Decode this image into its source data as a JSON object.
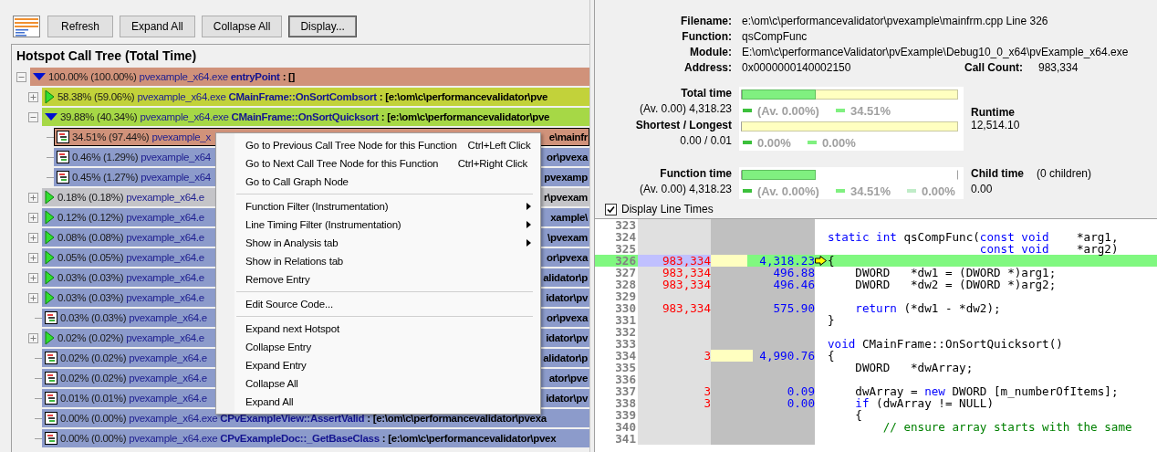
{
  "toolbar": {
    "buttons": [
      {
        "label": "Refresh",
        "default": false
      },
      {
        "label": "Expand All",
        "default": false
      },
      {
        "label": "Collapse All",
        "default": false
      },
      {
        "label": "Display...",
        "default": true
      }
    ]
  },
  "call_tree": {
    "title": "Hotspot Call Tree (Total Time)",
    "nodes": [
      {
        "kind": "branch",
        "expanded": true,
        "selected": false,
        "color": "#d0927a",
        "percent": "100.00% (100.00%)",
        "module": "pvexample_x64.exe",
        "function": "entryPoint",
        "location": ": []",
        "children": [
          {
            "kind": "branch",
            "expanded": false,
            "selected": false,
            "color": "#c2d23a",
            "percent": "58.38% (59.06%)",
            "module": "pvexample_x64.exe",
            "function": "CMainFrame::OnSortCombsort",
            "location": ": [e:\\om\\c\\performancevalidator\\pve"
          },
          {
            "kind": "branch",
            "expanded": true,
            "selected": false,
            "color": "#a6d846",
            "percent": "39.88% (40.34%)",
            "module": "pvexample_x64.exe",
            "function": "CMainFrame::OnSortQuicksort",
            "location": ": [e:\\om\\c\\performancevalidator\\pve",
            "children": [
              {
                "kind": "leaf",
                "selected": true,
                "color": "#d0927a",
                "percent": "34.51% (97.44%)",
                "module": "pvexample_x",
                "tail": "e\\mainfr"
              },
              {
                "kind": "leaf",
                "selected": false,
                "color": "#8c9bcb",
                "percent": "0.46% (1.29%)",
                "module": "pvexample_x64",
                "tail": "or\\pvexa"
              },
              {
                "kind": "leaf",
                "selected": false,
                "color": "#8c9bcb",
                "percent": "0.45% (1.27%)",
                "module": "pvexample_x64",
                "tail": "pvexamp"
              }
            ]
          },
          {
            "kind": "branch",
            "expanded": false,
            "selected": false,
            "color": "#c4c4c8",
            "percent": "0.18% (0.18%)",
            "module": "pvexample_x64.e",
            "tail": "r\\pvexam"
          },
          {
            "kind": "branch",
            "expanded": false,
            "selected": false,
            "color": "#8c9bcb",
            "percent": "0.12% (0.12%)",
            "module": "pvexample_x64.e",
            "tail": "xample\\"
          },
          {
            "kind": "branch",
            "expanded": false,
            "selected": false,
            "color": "#8c9bcb",
            "percent": "0.08% (0.08%)",
            "module": "pvexample_x64.e",
            "tail": "\\pvexam"
          },
          {
            "kind": "branch",
            "expanded": false,
            "selected": false,
            "color": "#8c9bcb",
            "percent": "0.05% (0.05%)",
            "module": "pvexample_x64.e",
            "tail": "or\\pvexa"
          },
          {
            "kind": "branch",
            "expanded": false,
            "selected": false,
            "color": "#8c9bcb",
            "percent": "0.03% (0.03%)",
            "module": "pvexample_x64.e",
            "tail": "alidator\\p"
          },
          {
            "kind": "branch",
            "expanded": false,
            "selected": false,
            "color": "#8c9bcb",
            "percent": "0.03% (0.03%)",
            "module": "pvexample_x64.e",
            "tail": "idator\\pv"
          },
          {
            "kind": "leaf",
            "selected": false,
            "color": "#8c9bcb",
            "percent": "0.03% (0.03%)",
            "module": "pvexample_x64.e",
            "tail": "or\\pvexa"
          },
          {
            "kind": "branch",
            "expanded": false,
            "selected": false,
            "color": "#8c9bcb",
            "percent": "0.02% (0.02%)",
            "module": "pvexample_x64.e",
            "tail": "idator\\pv"
          },
          {
            "kind": "leaf",
            "selected": false,
            "color": "#8c9bcb",
            "percent": "0.02% (0.02%)",
            "module": "pvexample_x64.e",
            "tail": "alidator\\p"
          },
          {
            "kind": "leaf",
            "selected": false,
            "color": "#8c9bcb",
            "percent": "0.02% (0.02%)",
            "module": "pvexample_x64.e",
            "tail": "ator\\pve"
          },
          {
            "kind": "leaf",
            "selected": false,
            "color": "#8c9bcb",
            "percent": "0.01% (0.01%)",
            "module": "pvexample_x64.e",
            "tail": "idator\\pv"
          },
          {
            "kind": "leaf",
            "selected": false,
            "color": "#8c9bcb",
            "percent": "0.00% (0.00%)",
            "module": "pvexample_x64.exe",
            "function": "CPvExampleView::AssertValid",
            "location": ": [e:\\om\\c\\performancevalidator\\pvexa"
          },
          {
            "kind": "leaf",
            "selected": false,
            "color": "#8c9bcb",
            "percent": "0.00% (0.00%)",
            "module": "pvexample_x64.exe",
            "function": "CPvExampleDoc::_GetBaseClass",
            "location": ": [e:\\om\\c\\performancevalidator\\pvex"
          }
        ]
      }
    ]
  },
  "context_menu": {
    "items": [
      {
        "kind": "item",
        "label": "Go to Previous Call Tree Node for this Function",
        "shortcut": "Ctrl+Left Click",
        "submenu": false
      },
      {
        "kind": "item",
        "label": "Go to Next Call Tree Node for this Function",
        "shortcut": "Ctrl+Right Click",
        "submenu": false
      },
      {
        "kind": "item",
        "label": "Go to Call Graph Node",
        "submenu": false
      },
      {
        "kind": "separator"
      },
      {
        "kind": "item",
        "label": "Function Filter (Instrumentation)",
        "submenu": true
      },
      {
        "kind": "item",
        "label": "Line Timing Filter (Instrumentation)",
        "submenu": true
      },
      {
        "kind": "item",
        "label": "Show in Analysis tab",
        "submenu": true
      },
      {
        "kind": "item",
        "label": "Show in Relations tab",
        "submenu": false
      },
      {
        "kind": "item",
        "label": "Remove Entry",
        "submenu": false
      },
      {
        "kind": "separator"
      },
      {
        "kind": "item",
        "label": "Edit Source Code...",
        "submenu": false
      },
      {
        "kind": "separator"
      },
      {
        "kind": "item",
        "label": "Expand next Hotspot",
        "submenu": false
      },
      {
        "kind": "item",
        "label": "Collapse Entry",
        "submenu": false
      },
      {
        "kind": "item",
        "label": "Expand Entry",
        "submenu": false
      },
      {
        "kind": "item",
        "label": "Collapse All",
        "submenu": false
      },
      {
        "kind": "item",
        "label": "Expand All",
        "submenu": false
      }
    ]
  },
  "details": {
    "fields": [
      {
        "label": "Filename:",
        "value": "e:\\om\\c\\performancevalidator\\pvexample\\mainfrm.cpp Line 326"
      },
      {
        "label": "Function:",
        "value": "qsCompFunc"
      },
      {
        "label": "Module:",
        "value": "E:\\om\\c\\performanceValidator\\pvExample\\Debug10_0_x64\\pvExample_x64.exe"
      },
      {
        "label": "Address:",
        "value": "0x0000000140002150"
      }
    ],
    "call_count": {
      "label": "Call Count:",
      "value": "983,334"
    },
    "metrics": [
      {
        "label": "Total time",
        "value": "(Av. 0.00) 4,318.23",
        "level": 0.345,
        "track": true,
        "legend": [
          {
            "text": "(Av. 0.00%)",
            "color": "#3cc03c"
          },
          {
            "text": "34.51%",
            "color": "#80f080"
          }
        ]
      },
      {
        "label": "Shortest / Longest",
        "value": "0.00 / 0.01",
        "track": true,
        "legend": [
          {
            "text": "0.00%",
            "color": "#3cc03c"
          },
          {
            "text": "0.00%",
            "color": "#80f080"
          }
        ]
      },
      {
        "label": "Function time",
        "value": "(Av. 0.00) 4,318.23",
        "level": 0.345,
        "track": false,
        "legend": [
          {
            "text": "(Av. 0.00%)",
            "color": "#3cc03c"
          },
          {
            "text": "34.51%",
            "color": "#80f080"
          },
          {
            "text": "0.00%",
            "color": "#c0ecc8"
          }
        ]
      }
    ],
    "runtime": {
      "label": "Runtime",
      "value": "12,514.10"
    },
    "child_time": {
      "label": "Child time",
      "note": "(0 children)",
      "value": "0.00"
    }
  },
  "display_line_times": {
    "label": "Display Line Times",
    "checked": true
  },
  "source": {
    "lines": [
      {
        "number": "323",
        "current": false
      },
      {
        "number": "324",
        "current": false,
        "segments": [
          {
            "kind": "keyword",
            "text": "static int"
          },
          {
            "kind": "code",
            "text": " qsCompFunc("
          },
          {
            "kind": "keyword",
            "text": "const void"
          },
          {
            "kind": "code",
            "text": "    *arg1,"
          }
        ]
      },
      {
        "number": "325",
        "current": false,
        "segments": [
          {
            "kind": "keyword",
            "text": "                      const void"
          },
          {
            "kind": "code",
            "text": "    *arg2)"
          }
        ]
      },
      {
        "number": "326",
        "current": true,
        "count": "983,334",
        "time": "4,318.23",
        "level": 0.35,
        "segments": [
          {
            "kind": "code",
            "text": "{"
          }
        ]
      },
      {
        "number": "327",
        "current": false,
        "count": "983,334",
        "time": "496.88",
        "segments": [
          {
            "kind": "code",
            "text": "    DWORD   *dw1 = (DWORD *)arg1;"
          }
        ]
      },
      {
        "number": "328",
        "current": false,
        "count": "983,334",
        "time": "496.46",
        "segments": [
          {
            "kind": "code",
            "text": "    DWORD   *dw2 = (DWORD *)arg2;"
          }
        ]
      },
      {
        "number": "329",
        "current": false
      },
      {
        "number": "330",
        "current": false,
        "count": "983,334",
        "time": "575.90",
        "segments": [
          {
            "kind": "keyword",
            "text": "    return"
          },
          {
            "kind": "code",
            "text": " (*dw1 - *dw2);"
          }
        ]
      },
      {
        "number": "331",
        "current": false,
        "segments": [
          {
            "kind": "code",
            "text": "}"
          }
        ]
      },
      {
        "number": "332",
        "current": false
      },
      {
        "number": "333",
        "current": false,
        "segments": [
          {
            "kind": "keyword",
            "text": "void"
          },
          {
            "kind": "code",
            "text": " CMainFrame::OnSortQuicksort()"
          }
        ]
      },
      {
        "number": "334",
        "current": false,
        "count": "3",
        "time": "4,990.76",
        "level": 0.4,
        "segments": [
          {
            "kind": "code",
            "text": "{"
          }
        ]
      },
      {
        "number": "335",
        "current": false,
        "segments": [
          {
            "kind": "code",
            "text": "    DWORD   *dwArray;"
          }
        ]
      },
      {
        "number": "336",
        "current": false
      },
      {
        "number": "337",
        "current": false,
        "count": "3",
        "time": "0.09",
        "segments": [
          {
            "kind": "code",
            "text": "    dwArray = "
          },
          {
            "kind": "keyword",
            "text": "new"
          },
          {
            "kind": "code",
            "text": " DWORD [m_numberOfItems];"
          }
        ]
      },
      {
        "number": "338",
        "current": false,
        "count": "3",
        "time": "0.00",
        "segments": [
          {
            "kind": "keyword",
            "text": "    if"
          },
          {
            "kind": "code",
            "text": " (dwArray != NULL)"
          }
        ]
      },
      {
        "number": "339",
        "current": false,
        "segments": [
          {
            "kind": "code",
            "text": "    {"
          }
        ]
      },
      {
        "number": "340",
        "current": false,
        "segments": [
          {
            "kind": "comment",
            "text": "        // ensure array starts with the same"
          }
        ]
      },
      {
        "number": "341",
        "current": false
      }
    ]
  }
}
